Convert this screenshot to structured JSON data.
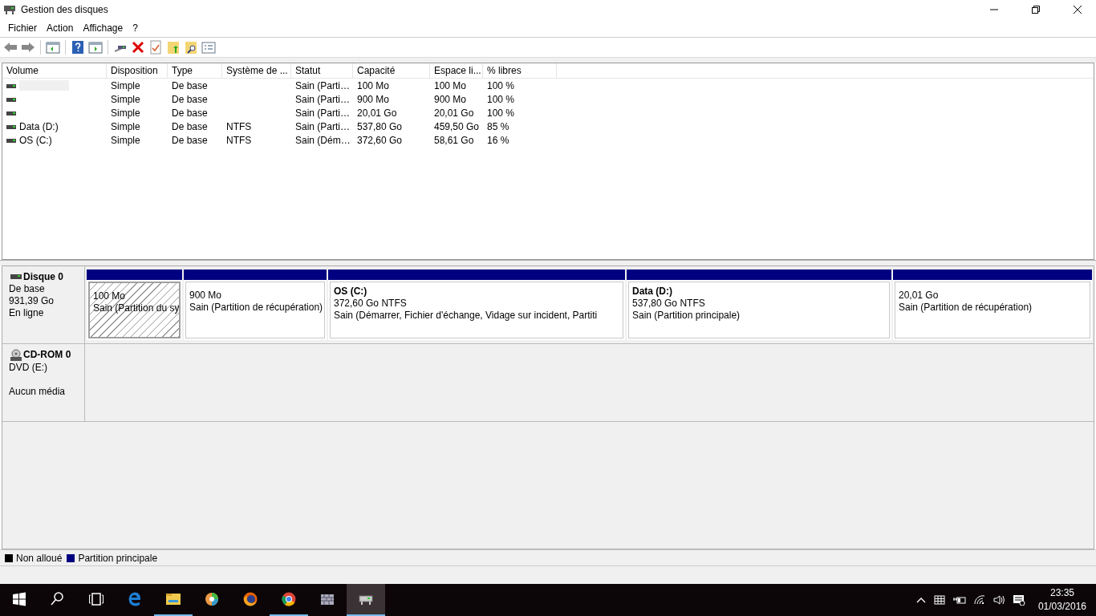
{
  "window": {
    "title": "Gestion des disques"
  },
  "menu": [
    "Fichier",
    "Action",
    "Affichage",
    "?"
  ],
  "volumes": {
    "columns": [
      "Volume",
      "Disposition",
      "Type",
      "Système de ...",
      "Statut",
      "Capacité",
      "Espace li...",
      "% libres"
    ],
    "rows": [
      {
        "name_hidden": true,
        "cells": [
          null,
          "Simple",
          "De base",
          null,
          "Sain (Parti…",
          "100 Mo",
          "100 Mo",
          "100 %"
        ]
      },
      {
        "name_hidden": false,
        "cells": [
          null,
          "Simple",
          "De base",
          null,
          "Sain (Parti…",
          "900 Mo",
          "900 Mo",
          "100 %"
        ]
      },
      {
        "name_hidden": false,
        "cells": [
          null,
          "Simple",
          "De base",
          null,
          "Sain (Parti…",
          "20,01 Go",
          "20,01 Go",
          "100 %"
        ]
      },
      {
        "name_hidden": false,
        "cells": [
          "Data (D:)",
          "Simple",
          "De base",
          "NTFS",
          "Sain (Parti…",
          "537,80 Go",
          "459,50 Go",
          "85 %"
        ]
      },
      {
        "name_hidden": false,
        "cells": [
          "OS (C:)",
          "Simple",
          "De base",
          "NTFS",
          "Sain (Dém…",
          "372,60 Go",
          "58,61 Go",
          "16 %"
        ]
      }
    ]
  },
  "disks": [
    {
      "kind": "hdd",
      "name": "Disque 0",
      "lines": [
        "De base",
        "931,39 Go",
        "En ligne"
      ],
      "partitions": [
        {
          "selected": true,
          "size": "100 Mo",
          "status": "Sain (Partition du sy"
        },
        {
          "selected": false,
          "size": "900 Mo",
          "status": "Sain (Partition de récupération)"
        },
        {
          "selected": false,
          "title": "OS  (C:)",
          "size": "372,60 Go NTFS",
          "status": "Sain (Démarrer, Fichier d'échange, Vidage sur incident, Partiti"
        },
        {
          "selected": false,
          "title": "Data  (D:)",
          "size": "537,80 Go NTFS",
          "status": "Sain (Partition principale)"
        },
        {
          "selected": false,
          "size": "20,01 Go",
          "status": "Sain (Partition de récupération)"
        }
      ]
    },
    {
      "kind": "cdrom",
      "name": "CD-ROM 0",
      "lines": [
        "DVD (E:)",
        "Aucun média"
      ]
    }
  ],
  "legend": [
    {
      "label": "Non alloué",
      "color": "#000000"
    },
    {
      "label": "Partition principale",
      "color": "#000080"
    }
  ],
  "taskbar": {
    "apps": [
      {
        "running": false,
        "selected": false
      },
      {
        "running": false,
        "selected": false
      },
      {
        "running": true,
        "selected": false
      },
      {
        "running": false,
        "selected": false
      },
      {
        "running": false,
        "selected": false
      },
      {
        "running": true,
        "selected": false
      },
      {
        "running": false,
        "selected": false
      },
      {
        "running": true,
        "selected": true
      }
    ],
    "time": "23:35",
    "date": "01/03/2016"
  }
}
